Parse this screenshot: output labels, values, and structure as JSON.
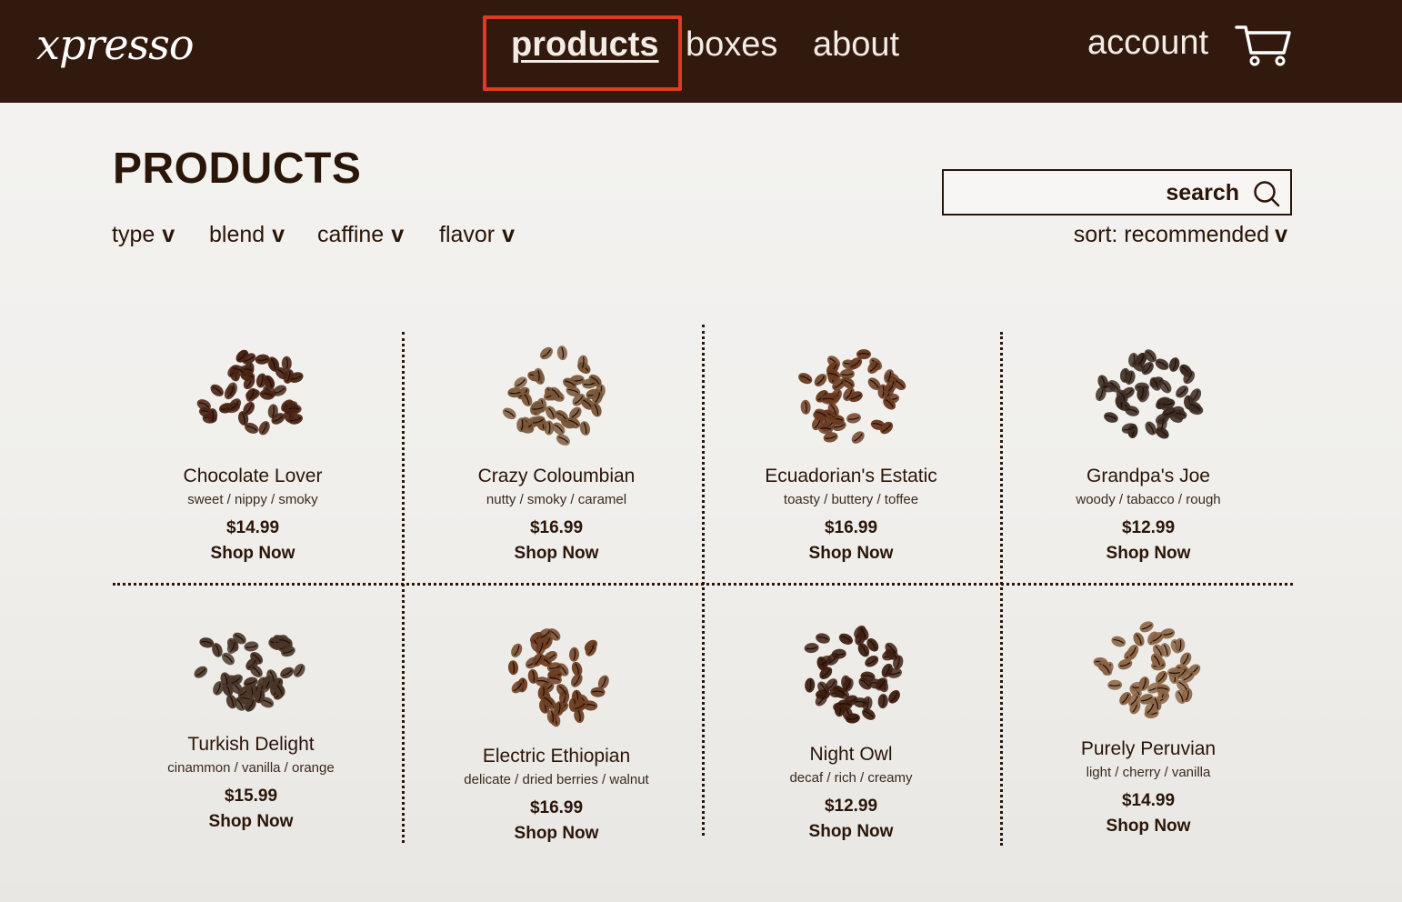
{
  "brand": {
    "logo_text": "xpresso"
  },
  "nav": {
    "products": "products",
    "boxes": "boxes",
    "about": "about",
    "account": "account",
    "cart_icon": "shopping-cart-icon",
    "highlight_color": "#e23a22"
  },
  "page": {
    "title": "PRODUCTS"
  },
  "filters": [
    {
      "label": "type",
      "chevron": "v"
    },
    {
      "label": "blend",
      "chevron": "v"
    },
    {
      "label": "caffine",
      "chevron": "v"
    },
    {
      "label": "flavor",
      "chevron": "v"
    }
  ],
  "search": {
    "label": "search",
    "icon": "search-icon"
  },
  "sort": {
    "label": "sort: recommended",
    "chevron": "v"
  },
  "colors": {
    "header_bg": "#31190d",
    "text": "#2a1509"
  },
  "products": [
    {
      "name": "Chocolate Lover",
      "notes": "sweet / nippy / smoky",
      "price": "$14.99",
      "cta": "Shop Now",
      "bean": "#4a2414"
    },
    {
      "name": "Crazy Coloumbian",
      "notes": "nutty / smoky / caramel",
      "price": "$16.99",
      "cta": "Shop Now",
      "bean": "#7a5638"
    },
    {
      "name": "Ecuadorian's Estatic",
      "notes": "toasty / buttery / toffee",
      "price": "$16.99",
      "cta": "Shop Now",
      "bean": "#6a3a20"
    },
    {
      "name": "Grandpa's Joe",
      "notes": "woody / tabacco / rough",
      "price": "$12.99",
      "cta": "Shop Now",
      "bean": "#3c2c22"
    },
    {
      "name": "Turkish Delight",
      "notes": "cinammon / vanilla / orange",
      "price": "$15.99",
      "cta": "Shop Now",
      "bean": "#4a3628"
    },
    {
      "name": "Electric Ethiopian",
      "notes": "delicate / dried berries / walnut",
      "price": "$16.99",
      "cta": "Shop Now",
      "bean": "#6e3e22"
    },
    {
      "name": "Night Owl",
      "notes": "decaf / rich / creamy",
      "price": "$12.99",
      "cta": "Shop Now",
      "bean": "#3e1e10"
    },
    {
      "name": "Purely Peruvian",
      "notes": "light / cherry / vanilla",
      "price": "$14.99",
      "cta": "Shop Now",
      "bean": "#8a6444"
    }
  ]
}
